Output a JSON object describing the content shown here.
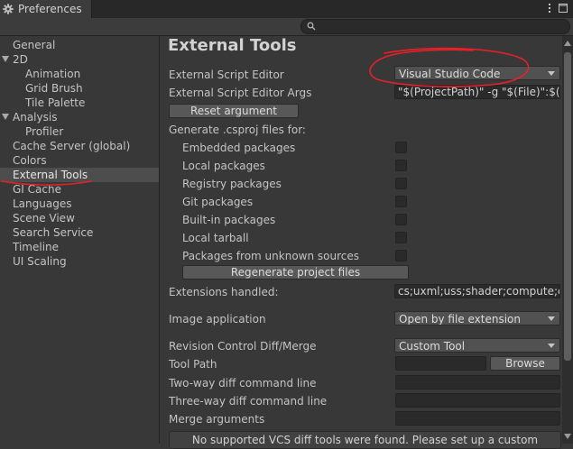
{
  "window": {
    "tab_title": "Preferences"
  },
  "search": {
    "placeholder": "",
    "value": ""
  },
  "sidebar": {
    "items": [
      {
        "label": "General",
        "indent": 0,
        "foldout": false,
        "selected": false
      },
      {
        "label": "2D",
        "indent": 0,
        "foldout": true,
        "selected": false
      },
      {
        "label": "Animation",
        "indent": 2,
        "foldout": false,
        "selected": false
      },
      {
        "label": "Grid Brush",
        "indent": 2,
        "foldout": false,
        "selected": false
      },
      {
        "label": "Tile Palette",
        "indent": 2,
        "foldout": false,
        "selected": false
      },
      {
        "label": "Analysis",
        "indent": 0,
        "foldout": true,
        "selected": false
      },
      {
        "label": "Profiler",
        "indent": 2,
        "foldout": false,
        "selected": false
      },
      {
        "label": "Cache Server (global)",
        "indent": 0,
        "foldout": false,
        "selected": false
      },
      {
        "label": "Colors",
        "indent": 0,
        "foldout": false,
        "selected": false
      },
      {
        "label": "External Tools",
        "indent": 0,
        "foldout": false,
        "selected": true
      },
      {
        "label": "GI Cache",
        "indent": 0,
        "foldout": false,
        "selected": false
      },
      {
        "label": "Languages",
        "indent": 0,
        "foldout": false,
        "selected": false
      },
      {
        "label": "Scene View",
        "indent": 0,
        "foldout": false,
        "selected": false
      },
      {
        "label": "Search Service",
        "indent": 0,
        "foldout": false,
        "selected": false
      },
      {
        "label": "Timeline",
        "indent": 0,
        "foldout": false,
        "selected": false
      },
      {
        "label": "UI Scaling",
        "indent": 0,
        "foldout": false,
        "selected": false
      }
    ]
  },
  "main": {
    "title": "External Tools",
    "script_editor": {
      "label": "External Script Editor",
      "value": "Visual Studio Code"
    },
    "script_editor_args": {
      "label": "External Script Editor Args",
      "value": "\"$(ProjectPath)\" -g \"$(File)\":$(Line):$(Column)"
    },
    "reset_button": "Reset argument",
    "csproj": {
      "label": "Generate .csproj files for:",
      "options": [
        {
          "label": "Embedded packages",
          "checked": false
        },
        {
          "label": "Local packages",
          "checked": false
        },
        {
          "label": "Registry packages",
          "checked": false
        },
        {
          "label": "Git packages",
          "checked": false
        },
        {
          "label": "Built-in packages",
          "checked": false
        },
        {
          "label": "Local tarball",
          "checked": false
        },
        {
          "label": "Packages from unknown sources",
          "checked": false
        }
      ],
      "regenerate_button": "Regenerate project files"
    },
    "extensions": {
      "label": "Extensions handled:",
      "value": "cs;uxml;uss;shader;compute;cginc;hlsl;glslinc;template;raytrace"
    },
    "image_app": {
      "label": "Image application",
      "value": "Open by file extension"
    },
    "revision": {
      "label": "Revision Control Diff/Merge",
      "value": "Custom Tool"
    },
    "tool_path": {
      "label": "Tool Path",
      "value": "",
      "browse_button": "Browse"
    },
    "two_way": {
      "label": "Two-way diff command line",
      "value": ""
    },
    "three_way": {
      "label": "Three-way diff command line",
      "value": ""
    },
    "merge_args": {
      "label": "Merge arguments",
      "value": ""
    },
    "help_box": "No supported VCS diff tools were found. Please set up a custom"
  },
  "colors": {
    "annotation": "#e8202a",
    "selection": "#4d4d4d",
    "background": "#383838"
  }
}
